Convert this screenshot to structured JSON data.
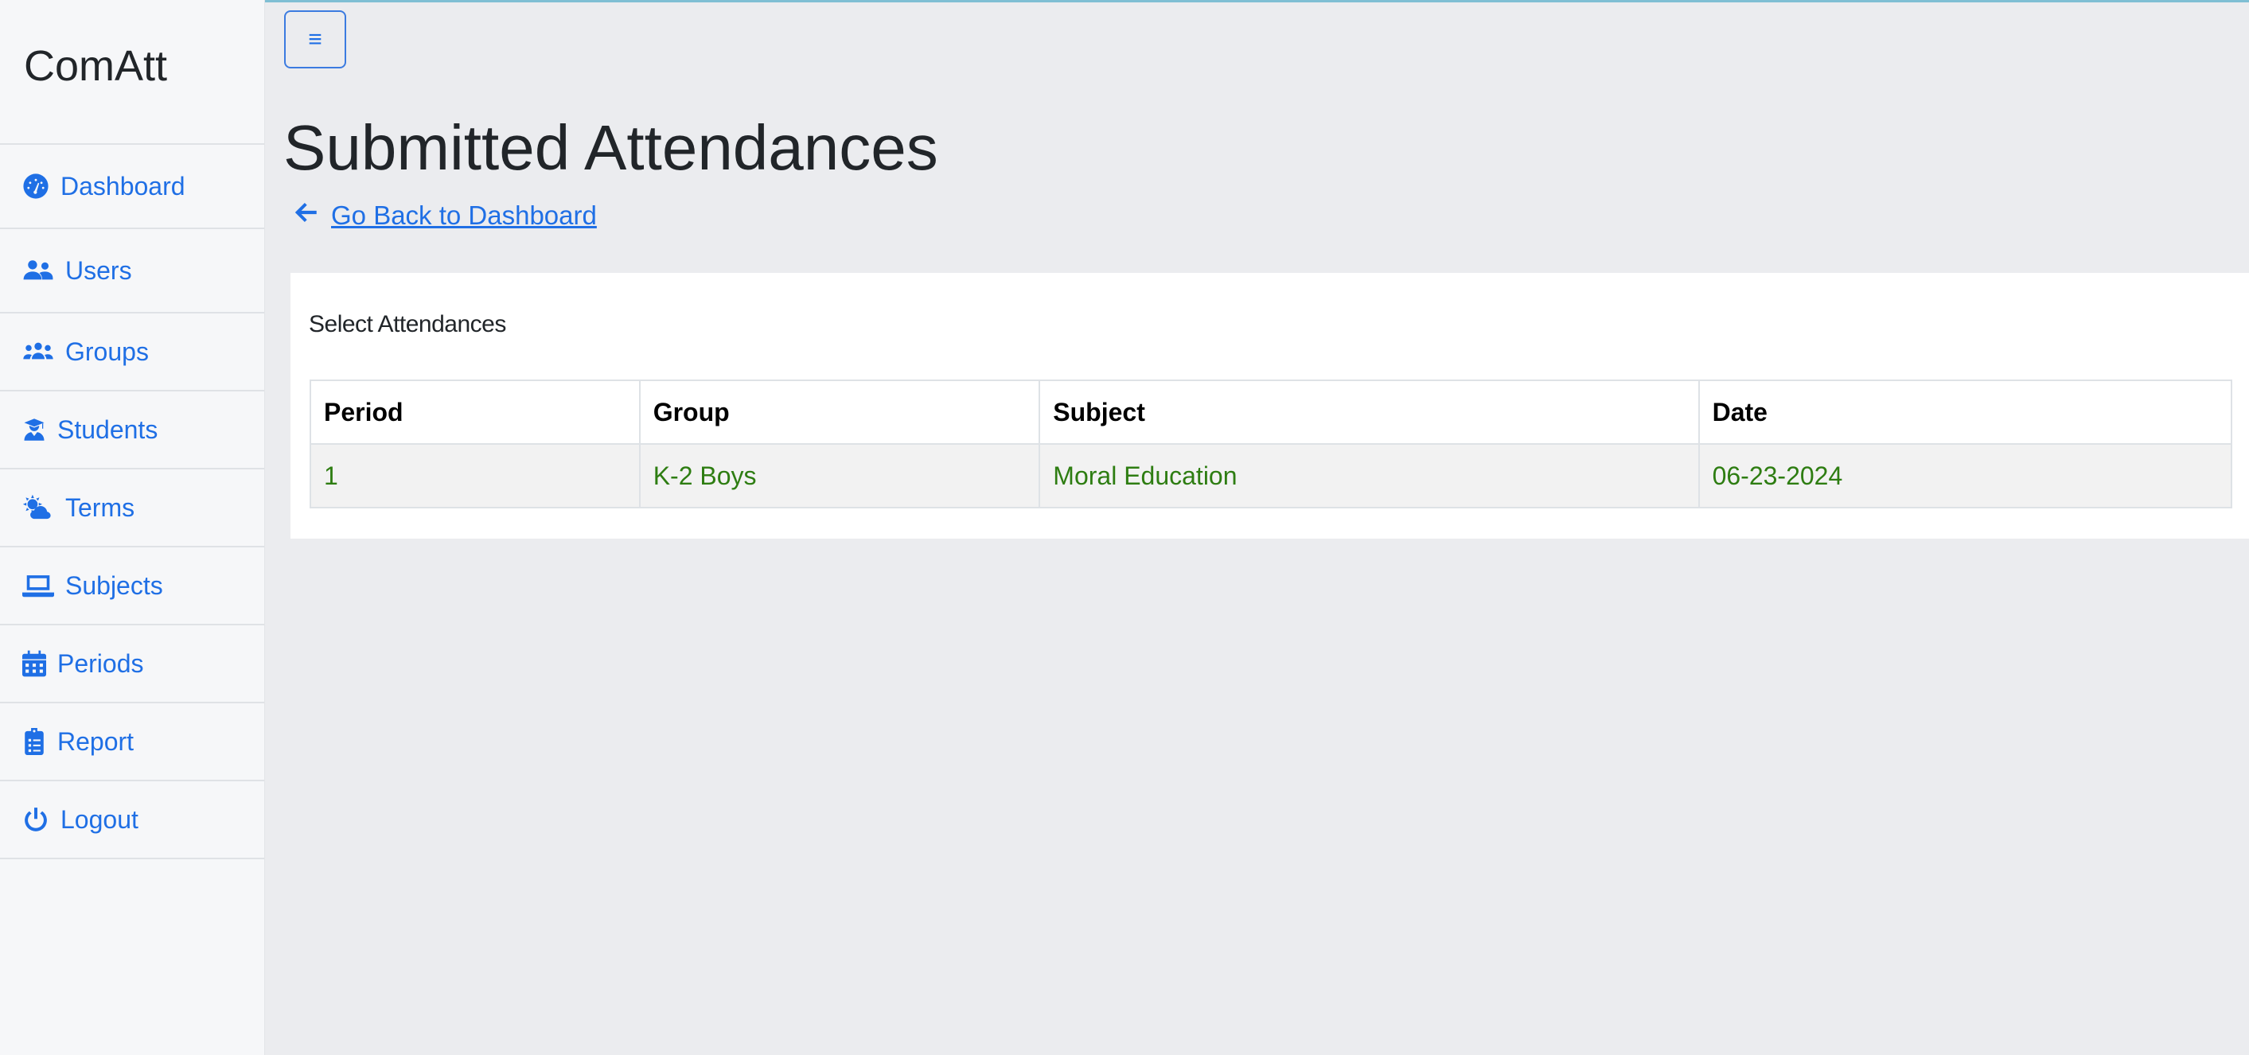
{
  "app": {
    "brand": "ComAtt"
  },
  "sidebar": {
    "items": [
      {
        "label": "Dashboard",
        "icon": "dashboard-icon"
      },
      {
        "label": "Users",
        "icon": "users-icon"
      },
      {
        "label": "Groups",
        "icon": "groups-icon"
      },
      {
        "label": "Students",
        "icon": "student-icon"
      },
      {
        "label": "Terms",
        "icon": "weather-icon"
      },
      {
        "label": "Subjects",
        "icon": "laptop-icon"
      },
      {
        "label": "Periods",
        "icon": "calendar-icon"
      },
      {
        "label": "Report",
        "icon": "clipboard-list-icon"
      },
      {
        "label": "Logout",
        "icon": "power-icon"
      }
    ]
  },
  "toolbar": {
    "toggle_label": "≡"
  },
  "main": {
    "title": "Submitted Attendances",
    "back_link": "Go Back to Dashboard",
    "card_title": "Select Attendances",
    "table": {
      "headers": [
        "Period",
        "Group",
        "Subject",
        "Date"
      ],
      "rows": [
        [
          "1",
          "K-2 Boys",
          "Moral Education",
          "06-23-2024"
        ]
      ]
    }
  },
  "colors": {
    "accent": "#1f6fe5",
    "row_text": "#2e7d12",
    "background": "#ebecef",
    "sidebar": "#f6f7f9"
  }
}
